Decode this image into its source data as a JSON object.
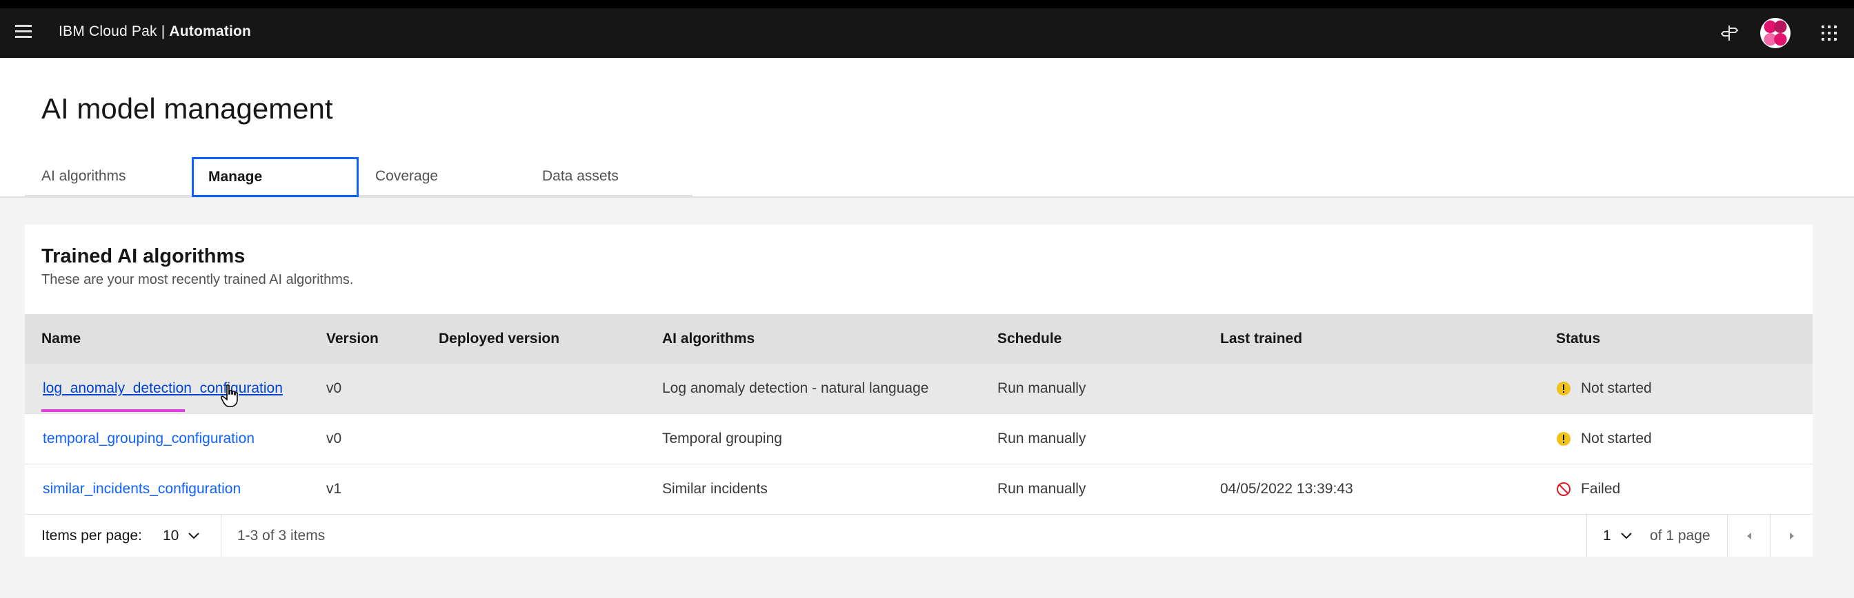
{
  "header": {
    "brand_prefix": "IBM Cloud Pak | ",
    "brand_product": "Automation"
  },
  "page": {
    "title": "AI model management",
    "tabs": [
      {
        "label": "AI algorithms",
        "active": false
      },
      {
        "label": "Manage",
        "active": true
      },
      {
        "label": "Coverage",
        "active": false
      },
      {
        "label": "Data assets",
        "active": false
      }
    ]
  },
  "card": {
    "title": "Trained AI algorithms",
    "subtitle": "These are your most recently trained AI algorithms."
  },
  "table": {
    "columns": [
      "Name",
      "Version",
      "Deployed version",
      "AI algorithms",
      "Schedule",
      "Last trained",
      "Status"
    ],
    "rows": [
      {
        "name": "log_anomaly_detection_configuration",
        "version": "v0",
        "deployed": "",
        "algorithm": "Log anomaly detection - natural language",
        "schedule": "Run manually",
        "last_trained": "",
        "status": "Not started"
      },
      {
        "name": "temporal_grouping_configuration",
        "version": "v0",
        "deployed": "",
        "algorithm": "Temporal grouping",
        "schedule": "Run manually",
        "last_trained": "",
        "status": "Not started"
      },
      {
        "name": "similar_incidents_configuration",
        "version": "v1",
        "deployed": "",
        "algorithm": "Similar incidents",
        "schedule": "Run manually",
        "last_trained": "04/05/2022 13:39:43",
        "status": "Failed"
      }
    ]
  },
  "pagination": {
    "items_label": "Items per page:",
    "items_value": "10",
    "range_text": "1-3 of 3 items",
    "page_value": "1",
    "of_pages": "of 1 page"
  },
  "colors": {
    "link": "#0f62fe",
    "warning": "#f1c21b",
    "error": "#da1e28",
    "active_tab": "#0f62fe",
    "highlight_underline": "#e03ee0"
  }
}
